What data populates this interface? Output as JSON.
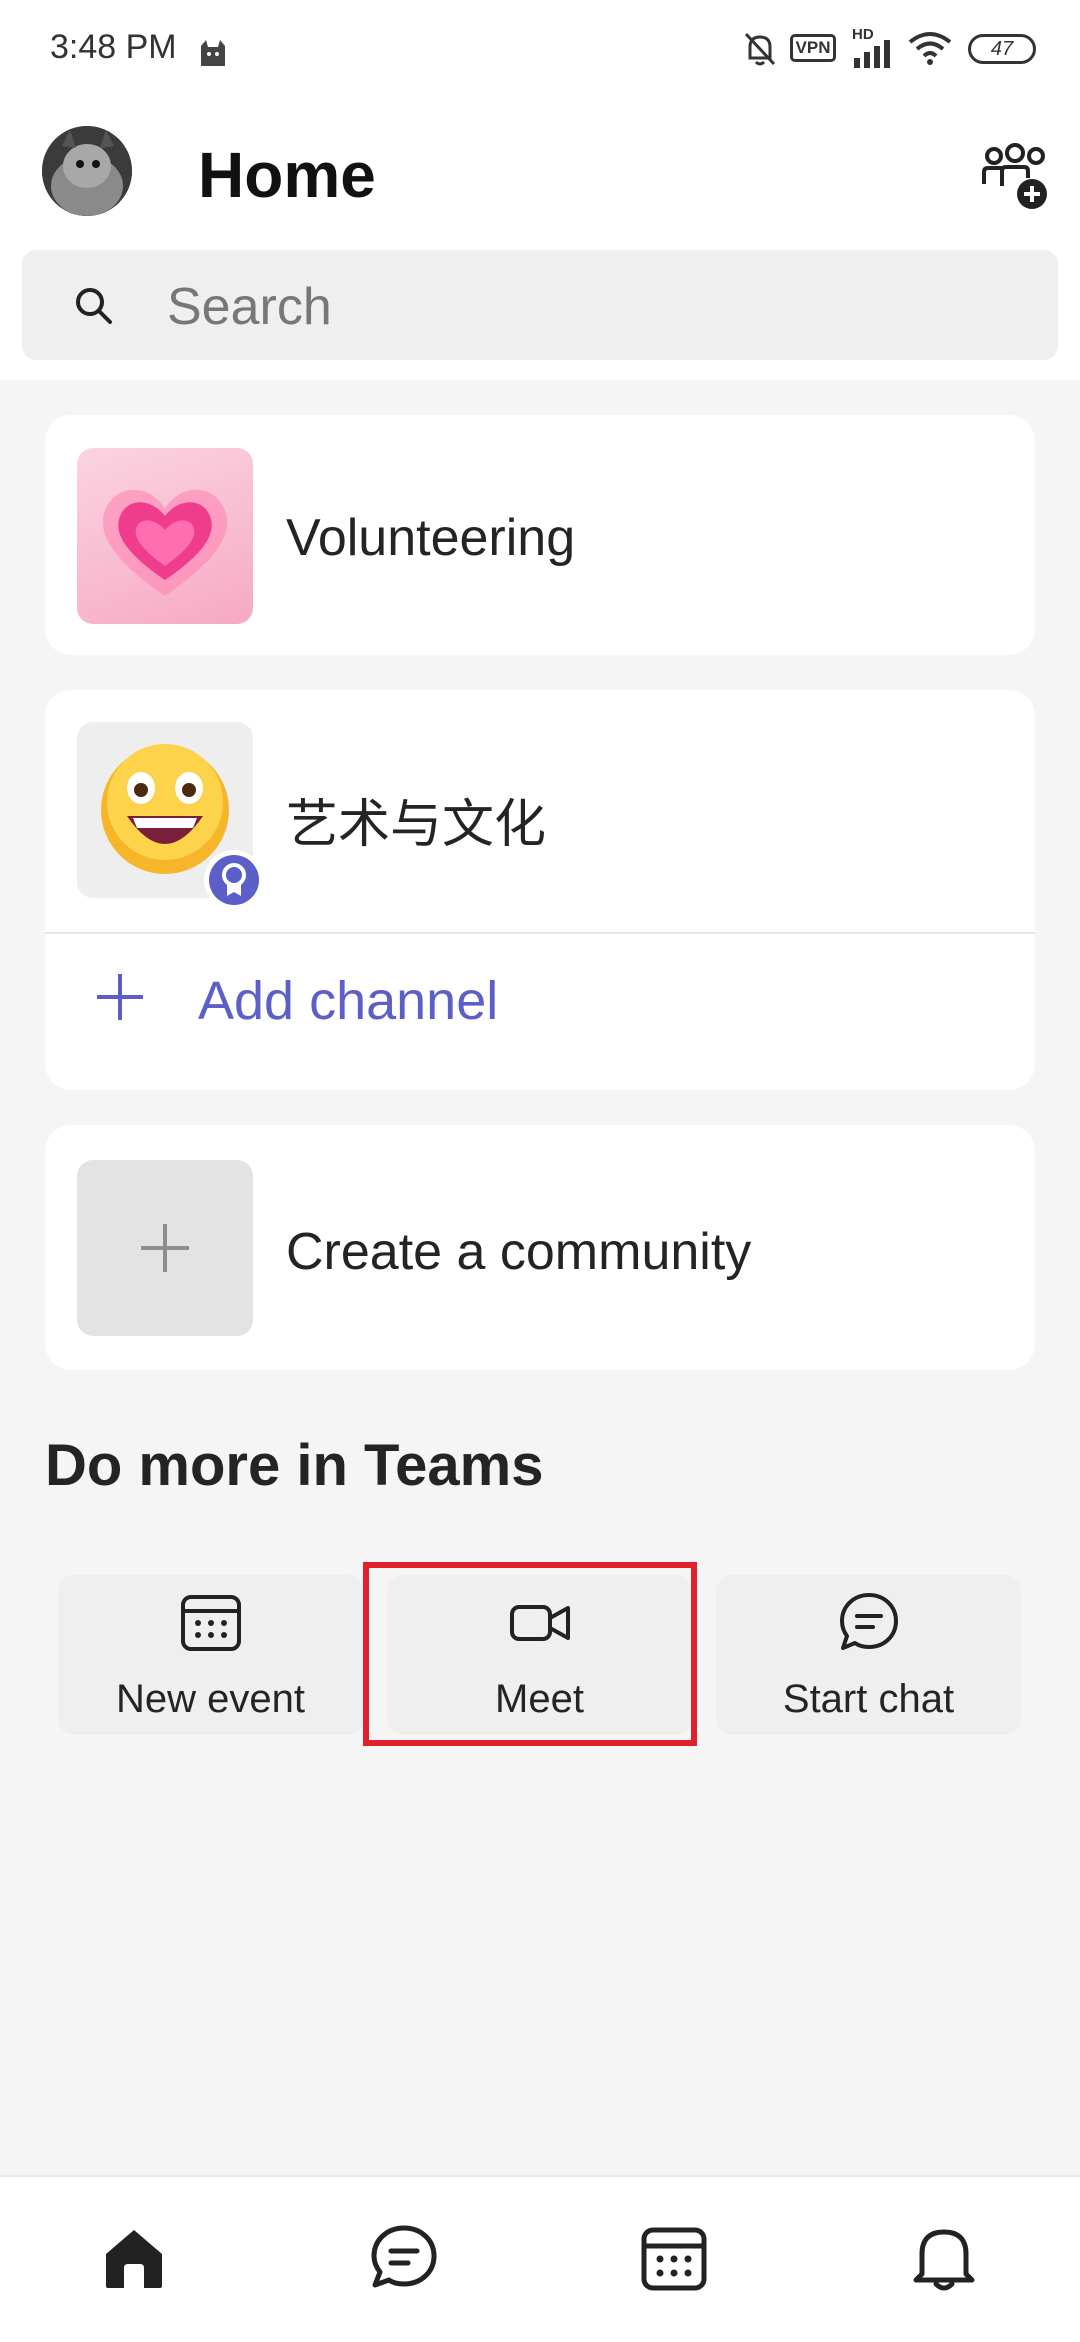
{
  "status_bar": {
    "time": "3:48 PM",
    "vpn_label": "VPN",
    "hd_label": "HD",
    "battery_level": "47"
  },
  "header": {
    "title": "Home"
  },
  "search": {
    "placeholder": "Search"
  },
  "communities": [
    {
      "name": "Volunteering",
      "icon": "pink-heart-emoji"
    },
    {
      "name": "艺术与文化",
      "icon": "grinning-face-emoji",
      "badge_icon": "award-badge-icon"
    }
  ],
  "add_channel": {
    "label": "Add channel"
  },
  "create_community": {
    "label": "Create a community"
  },
  "do_more": {
    "title": "Do more in Teams",
    "actions": [
      {
        "label": "New event",
        "icon": "calendar-icon"
      },
      {
        "label": "Meet",
        "icon": "video-camera-icon"
      },
      {
        "label": "Start chat",
        "icon": "chat-icon"
      }
    ]
  },
  "bottom_nav": {
    "items": [
      {
        "icon": "home-icon",
        "active": true
      },
      {
        "icon": "chat-icon",
        "active": false
      },
      {
        "icon": "calendar-icon",
        "active": false
      },
      {
        "icon": "bell-icon",
        "active": false
      }
    ]
  },
  "colors": {
    "accent": "#5b5fc7",
    "highlight": "#e0202a",
    "card_background": "#ffffff",
    "page_background": "#f5f5f5"
  }
}
